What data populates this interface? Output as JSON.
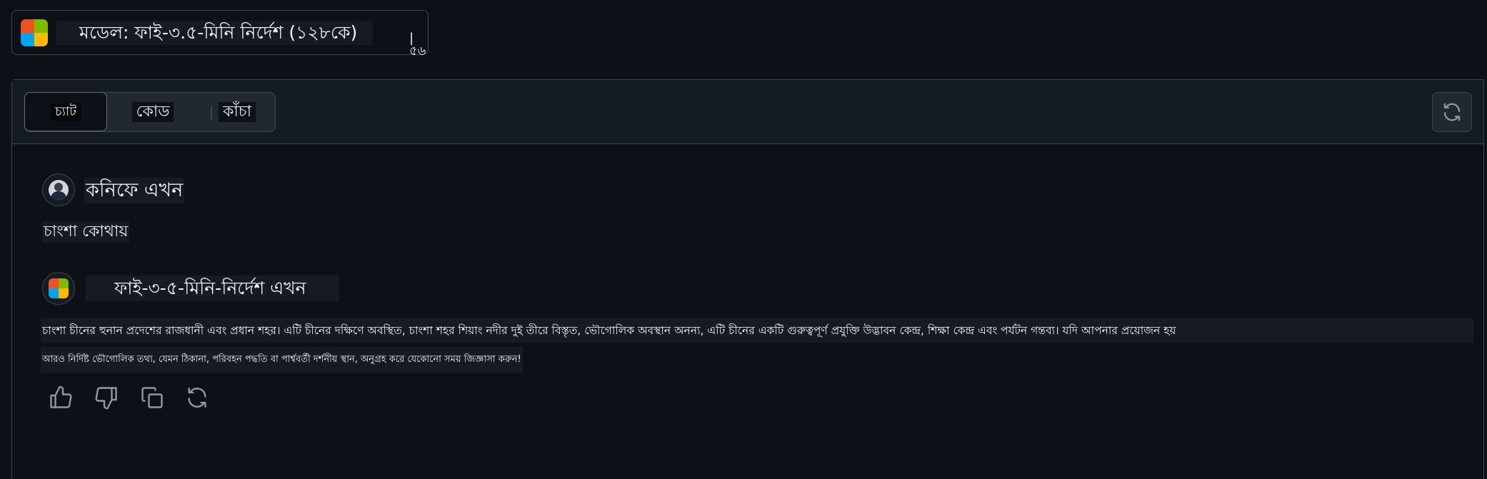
{
  "header": {
    "model_label": "মডেল: ফাই-৩.৫-মিনি নির্দেশ (১২৮কে)",
    "model_suffix": "|৫৬",
    "logo_colors": [
      "#f25022",
      "#7fba00",
      "#00a4ef",
      "#ffb900"
    ]
  },
  "tabs": {
    "chat": "চ্যাট",
    "code": "কোড",
    "raw": "কাঁচা"
  },
  "conversation": {
    "user": {
      "sender": "কনিফে এখন",
      "message": "চাংশা কোথায়"
    },
    "assistant": {
      "sender": "ফাই-৩-৫-মিনি-নির্দেশ এখন",
      "line1": "চাংশা চীনের হুনান প্রদেশের রাজধানী এবং প্রধান শহর। এটি চীনের দক্ষিণে অবস্থিত, চাংশা শহর শিয়াং নদীর দুই তীরে বিস্তৃত, ভৌগোলিক অবস্থান অনন্য, এটি চীনের একটি গুরুত্বপূর্ণ প্রযুক্তি উদ্ভাবন কেন্দ্র, শিক্ষা কেন্দ্র এবং পর্যটন গন্তব্য। যদি আপনার প্রয়োজন হয়",
      "line2": "আরও নির্দিষ্ট ভৌগোলিক তথ্য, যেমন ঠিকানা, পরিবহন পদ্ধতি বা পার্শ্ববর্তী দর্শনীয় স্থান, অনুগ্রহ করে যেকোনো সময় জিজ্ঞাসা করুন!"
    }
  },
  "actions": [
    "thumbs-up-icon",
    "thumbs-down-icon",
    "copy-icon",
    "regenerate-icon"
  ],
  "colors": {
    "background": "#0d1117",
    "header": "#151b23",
    "border": "#3d444d",
    "icon": "#9198a1"
  }
}
